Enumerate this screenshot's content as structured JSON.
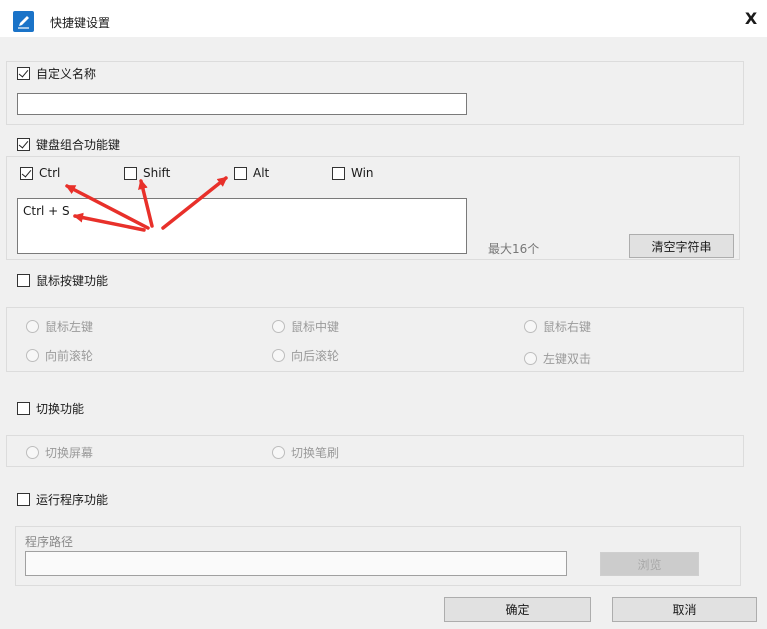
{
  "window": {
    "title": "快捷键设置",
    "close_label": "X"
  },
  "custom_name": {
    "label": "自定义名称",
    "checked": true,
    "value": ""
  },
  "key_combo": {
    "label": "键盘组合功能键",
    "checked": true,
    "modifiers": [
      {
        "label": "Ctrl",
        "checked": true
      },
      {
        "label": "Shift",
        "checked": false
      },
      {
        "label": "Alt",
        "checked": false
      },
      {
        "label": "Win",
        "checked": false
      }
    ],
    "combo_text": "Ctrl + S",
    "max_hint": "最大16个",
    "clear_button": "清空字符串"
  },
  "mouse": {
    "label": "鼠标按键功能",
    "checked": false,
    "options": [
      "鼠标左键",
      "鼠标中键",
      "鼠标右键",
      "向前滚轮",
      "向后滚轮",
      "左键双击"
    ]
  },
  "switch": {
    "label": "切换功能",
    "checked": false,
    "options": [
      "切换屏幕",
      "切换笔刷"
    ]
  },
  "run_program": {
    "label": "运行程序功能",
    "checked": false,
    "path_label": "程序路径",
    "path_value": "",
    "browse_button": "浏览"
  },
  "footer": {
    "ok_button": "确定",
    "cancel_button": "取消"
  },
  "colors": {
    "annotation_arrow": "#e8302a",
    "app_icon": "#1a73c8"
  }
}
